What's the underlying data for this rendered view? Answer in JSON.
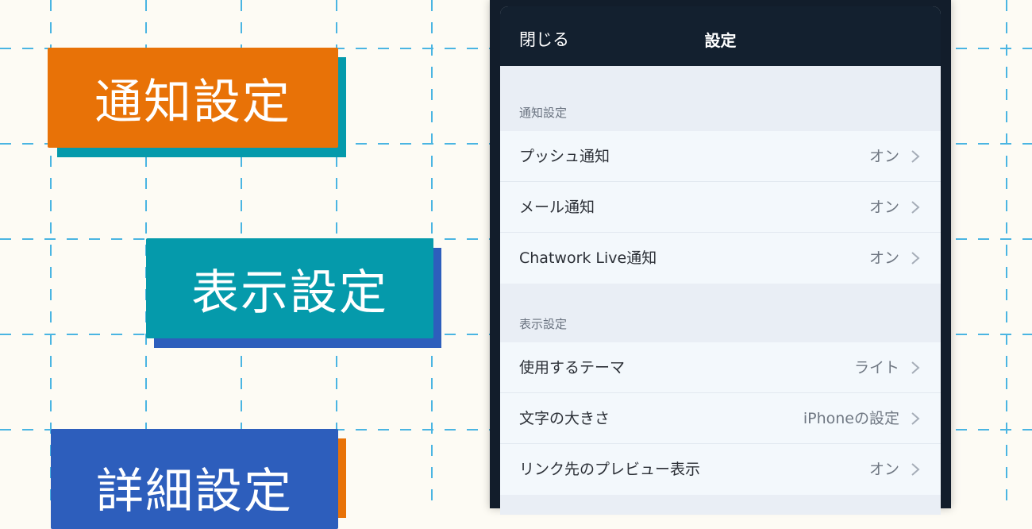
{
  "labels": {
    "notifications": "通知設定",
    "display": "表示設定",
    "advanced": "詳細設定"
  },
  "phone": {
    "nav": {
      "close": "閉じる",
      "title": "設定"
    },
    "sections": [
      {
        "header": "通知設定",
        "rows": [
          {
            "label": "プッシュ通知",
            "value": "オン"
          },
          {
            "label": "メール通知",
            "value": "オン"
          },
          {
            "label": "Chatwork Live通知",
            "value": "オン"
          }
        ]
      },
      {
        "header": "表示設定",
        "rows": [
          {
            "label": "使用するテーマ",
            "value": "ライト"
          },
          {
            "label": "文字の大きさ",
            "value": "iPhoneの設定"
          },
          {
            "label": "リンク先のプレビュー表示",
            "value": "オン"
          }
        ]
      }
    ]
  },
  "colors": {
    "orange": "#e87207",
    "teal": "#059aab",
    "blue": "#2d5ebc",
    "navy": "#13202f",
    "grid": "#4ab5e2"
  },
  "icons": [
    "chevron-right-icon"
  ]
}
